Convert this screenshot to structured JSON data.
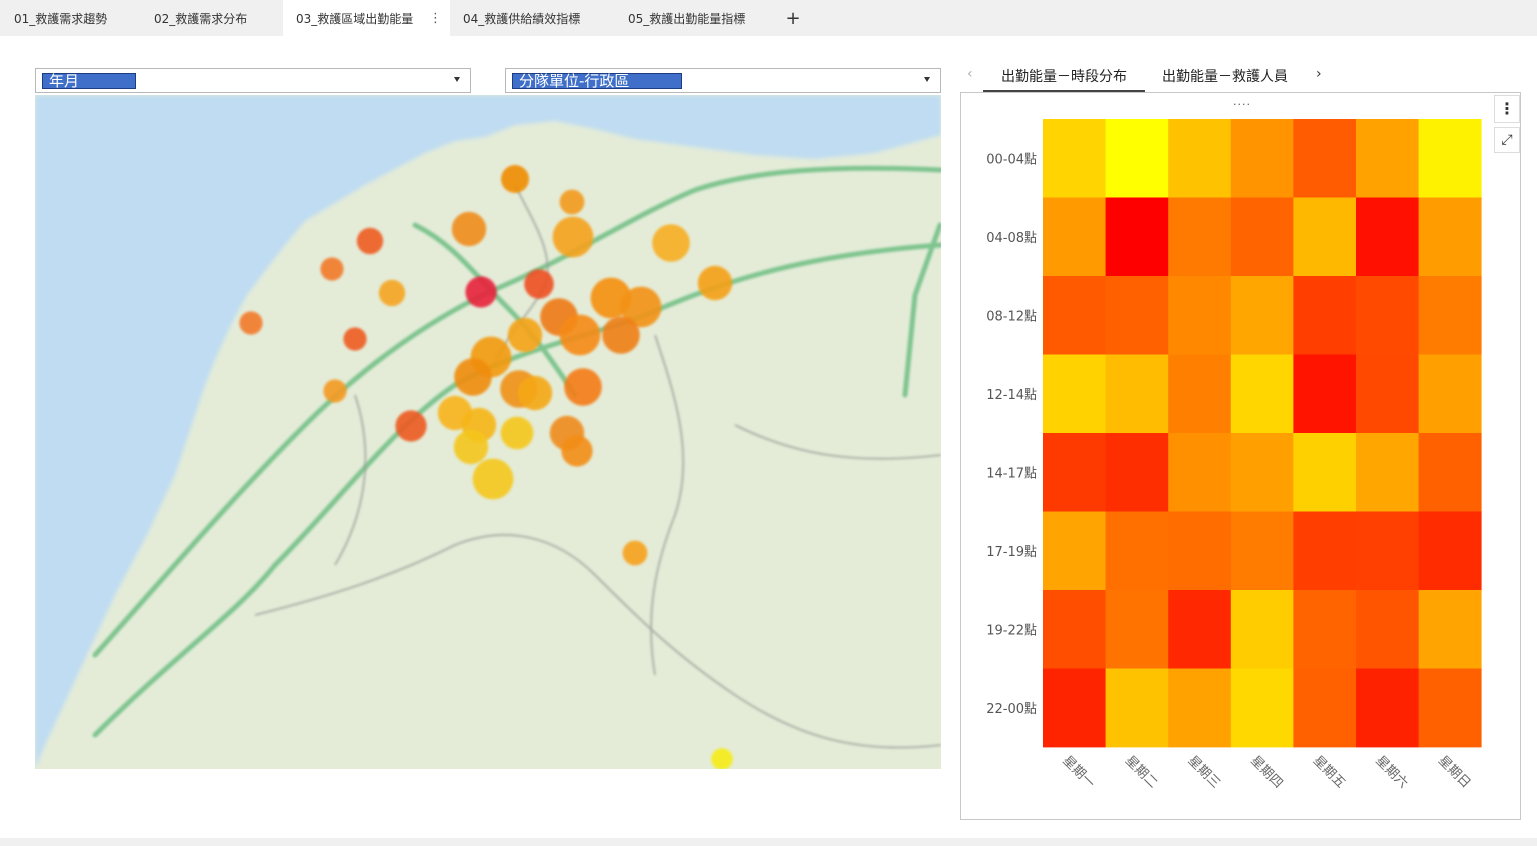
{
  "tabs": [
    {
      "label": "01_救護需求趨勢"
    },
    {
      "label": "02_救護需求分布"
    },
    {
      "label": "03_救護區域出勤能量"
    },
    {
      "label": "04_救護供給績效指標"
    },
    {
      "label": "05_救護出勤能量指標"
    }
  ],
  "active_tab": 2,
  "add_tab_label": "+",
  "tab_more_icon": "⋮",
  "filters": {
    "year_month_label": "年月",
    "unit_district_label": "分隊單位-行政區"
  },
  "panel_tabs": {
    "prev_icon": "‹",
    "next_icon": "›",
    "items": [
      {
        "label": "出勤能量－時段分布"
      },
      {
        "label": "出勤能量－救護人員"
      }
    ],
    "active": 0
  },
  "card": {
    "grip_label": "....",
    "menu_icon": "⋮",
    "expand_icon": "⤢"
  },
  "map": {
    "colors": {
      "sea": "#bfdcf2",
      "land": "#e4ecd8",
      "road": "#7fc48f",
      "border": "#9ea39a"
    },
    "bubbles": [
      {
        "color": "#f08c00",
        "level": 0.5
      },
      {
        "color": "#f39a1a",
        "level": 0.4
      },
      {
        "color": "#f08c1a",
        "level": 0.7
      },
      {
        "color": "#f5a21f",
        "level": 0.9
      },
      {
        "color": "#f7ae24",
        "level": 0.8
      },
      {
        "color": "#ef5c22",
        "level": 0.45
      },
      {
        "color": "#f27a2a",
        "level": 0.35
      },
      {
        "color": "#f5a522",
        "level": 0.45
      },
      {
        "color": "#e8223a",
        "level": 0.6
      },
      {
        "color": "#ee5020",
        "level": 0.55
      },
      {
        "color": "#f58f10",
        "level": 0.9
      },
      {
        "color": "#f39212",
        "level": 0.9
      },
      {
        "color": "#f5a018",
        "level": 0.7
      },
      {
        "color": "#ef7a18",
        "level": 0.8
      },
      {
        "color": "#f58a14",
        "level": 0.9
      },
      {
        "color": "#f07f14",
        "level": 0.8
      },
      {
        "color": "#f5a318",
        "level": 0.7
      },
      {
        "color": "#f39a10",
        "level": 0.9
      },
      {
        "color": "#f08c10",
        "level": 0.8
      },
      {
        "color": "#f09114",
        "level": 0.8
      },
      {
        "color": "#f47c14",
        "level": 0.8
      },
      {
        "color": "#f5a818",
        "level": 0.7
      },
      {
        "color": "#f8b41a",
        "level": 0.7
      },
      {
        "color": "#ed5a22",
        "level": 0.6
      },
      {
        "color": "#f6b519",
        "level": 0.7
      },
      {
        "color": "#f4c61a",
        "level": 0.7
      },
      {
        "color": "#f5c71a",
        "level": 0.65
      },
      {
        "color": "#f5c81a",
        "level": 0.9
      },
      {
        "color": "#f08b1c",
        "level": 0.7
      },
      {
        "color": "#f38d18",
        "level": 0.6
      },
      {
        "color": "#f49a22",
        "level": 0.35
      },
      {
        "color": "#ef5c20",
        "level": 0.35
      },
      {
        "color": "#f27a2a",
        "level": 0.35
      },
      {
        "color": "#f6ec12",
        "level": 0.3
      },
      {
        "color": "#f7a11d",
        "level": 0.4
      }
    ]
  },
  "chart_data": {
    "type": "heatmap",
    "rows": [
      "00-04點",
      "04-08點",
      "08-12點",
      "12-14點",
      "14-17點",
      "17-19點",
      "19-22點",
      "22-00點"
    ],
    "columns": [
      "星期一",
      "星期二",
      "星期三",
      "星期四",
      "星期五",
      "星期六",
      "星期日"
    ],
    "colors": [
      [
        "#ffd400",
        "#ffff00",
        "#ffc200",
        "#ff9400",
        "#ff5b00",
        "#ffa200",
        "#fff200"
      ],
      [
        "#ff9a00",
        "#ff0000",
        "#ff7a00",
        "#ff6400",
        "#ffb800",
        "#ff1000",
        "#ff9c00"
      ],
      [
        "#ff5a00",
        "#ff6000",
        "#ff8800",
        "#ffa600",
        "#ff3e00",
        "#ff4a00",
        "#ff7c00"
      ],
      [
        "#ffd200",
        "#ffbc00",
        "#ff8000",
        "#ffd600",
        "#ff1400",
        "#ff4800",
        "#ffa000"
      ],
      [
        "#ff3a00",
        "#ff2e00",
        "#ff9000",
        "#ffa000",
        "#ffd000",
        "#ffa600",
        "#ff6000"
      ],
      [
        "#ffa400",
        "#ff7000",
        "#ff6c00",
        "#ff7c00",
        "#ff3e00",
        "#ff4000",
        "#ff2c00"
      ],
      [
        "#ff4e00",
        "#ff7400",
        "#ff2800",
        "#ffcc00",
        "#ff6400",
        "#ff5400",
        "#ffa400"
      ],
      [
        "#ff2400",
        "#ffc200",
        "#ffa200",
        "#ffd800",
        "#ff6000",
        "#ff2200",
        "#ff6000"
      ]
    ],
    "grid": false,
    "legend": "none"
  }
}
